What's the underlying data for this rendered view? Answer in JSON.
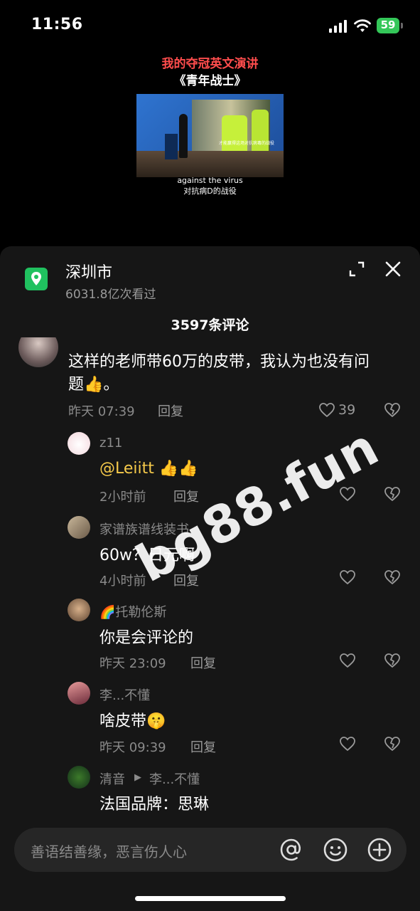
{
  "status_bar": {
    "time": "11:56",
    "battery": "59",
    "battery_color": "#34c759"
  },
  "video": {
    "title_line1": "我的夺冠英文演讲",
    "title_line2": "《青年战士》",
    "screen_caption": "才能赢得这场对抗病毒的战役",
    "subtitle_en": "against the virus",
    "subtitle_cn": "对抗病D的战役",
    "accent_color": "#ff4d4d"
  },
  "location": {
    "city": "深圳市",
    "views": "6031.8亿次看过",
    "icon": "location-pin-icon"
  },
  "comments_header": "3597条评论",
  "comments": [
    {
      "text_line1": "这样的老师带60万的皮带，我认为也没有问",
      "text_line2": "题👍。",
      "time": "昨天 07:39",
      "reply": "回复",
      "likes": "39"
    }
  ],
  "replies": [
    {
      "user": "z11",
      "text": "@Leiitt 👍👍",
      "time": "2小时前",
      "reply": "回复"
    },
    {
      "user": "家谱族谱线装书",
      "text": "60w？日元啊",
      "time": "4小时前",
      "reply": "回复"
    },
    {
      "user": "🌈托勒伦斯",
      "text": "你是会评论的",
      "time": "昨天 23:09",
      "reply": "回复"
    },
    {
      "user": "李...不懂",
      "text": "啥皮带🤫",
      "time": "昨天 09:39",
      "reply": "回复"
    },
    {
      "user": "清音",
      "reply_to": "李...不懂",
      "text": "法国品牌：思琳"
    }
  ],
  "input": {
    "placeholder": "善语结善缘，恶言伤人心"
  },
  "watermark": "bg88.fun"
}
